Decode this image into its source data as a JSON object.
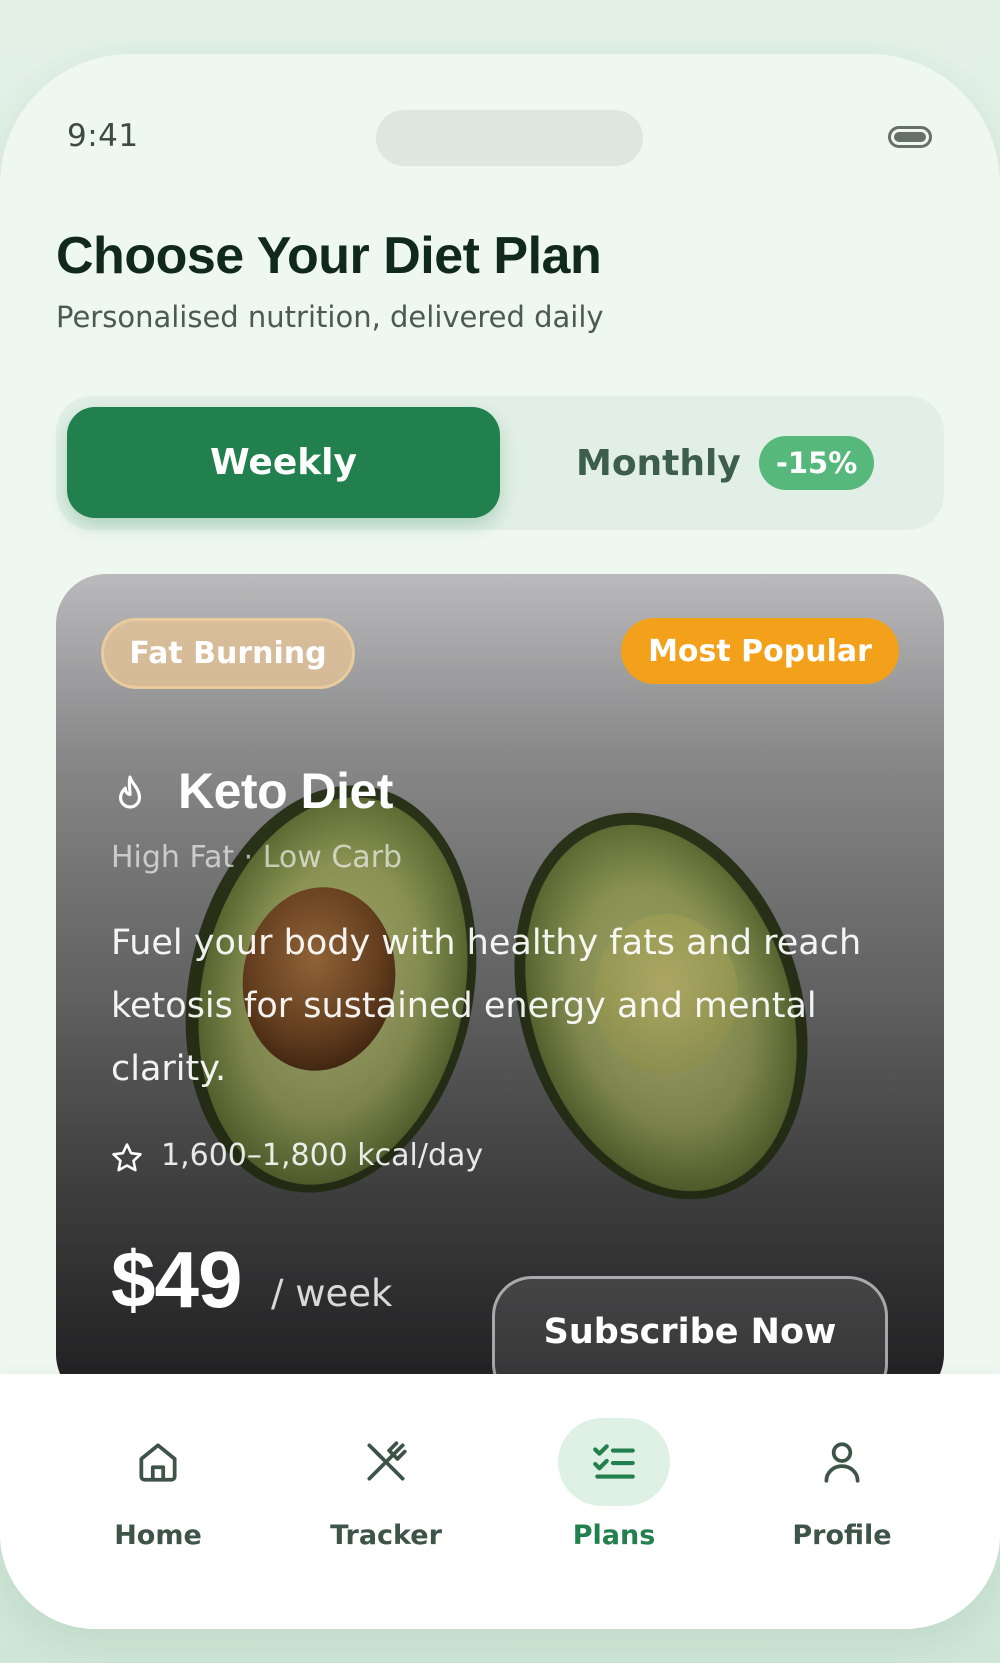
{
  "status_bar": {
    "time": "9:41"
  },
  "header": {
    "title": "Choose Your Diet Plan",
    "subtitle": "Personalised nutrition, delivered daily"
  },
  "billing_toggle": {
    "weekly_label": "Weekly",
    "monthly_label": "Monthly",
    "monthly_discount": "-15%",
    "selected": "Weekly"
  },
  "plan_card": {
    "tag": "Fat Burning",
    "highlight_badge": "Most Popular",
    "name": "Keto Diet",
    "macros": "High Fat · Low Carb",
    "description": "Fuel your body with healthy fats and reach ketosis for sustained energy and mental clarity.",
    "calories": "1,600–1,800 kcal/day",
    "price": "$49",
    "period": "/ week",
    "cta_label": "Subscribe Now",
    "icons": {
      "plan_icon": "flame-icon",
      "calories_icon": "star-icon"
    },
    "colors": {
      "highlight_badge": "#f3a11a",
      "tag": "#e6c396"
    }
  },
  "bottom_nav": {
    "items": [
      {
        "label": "Home",
        "icon": "home-icon"
      },
      {
        "label": "Tracker",
        "icon": "utensils-icon"
      },
      {
        "label": "Plans",
        "icon": "checklist-icon"
      },
      {
        "label": "Profile",
        "icon": "user-icon"
      }
    ],
    "active": "Plans"
  },
  "colors": {
    "primary": "#21804d",
    "primary_light": "#56b87b",
    "background": "#eff7f1",
    "title_text": "#10291c"
  }
}
